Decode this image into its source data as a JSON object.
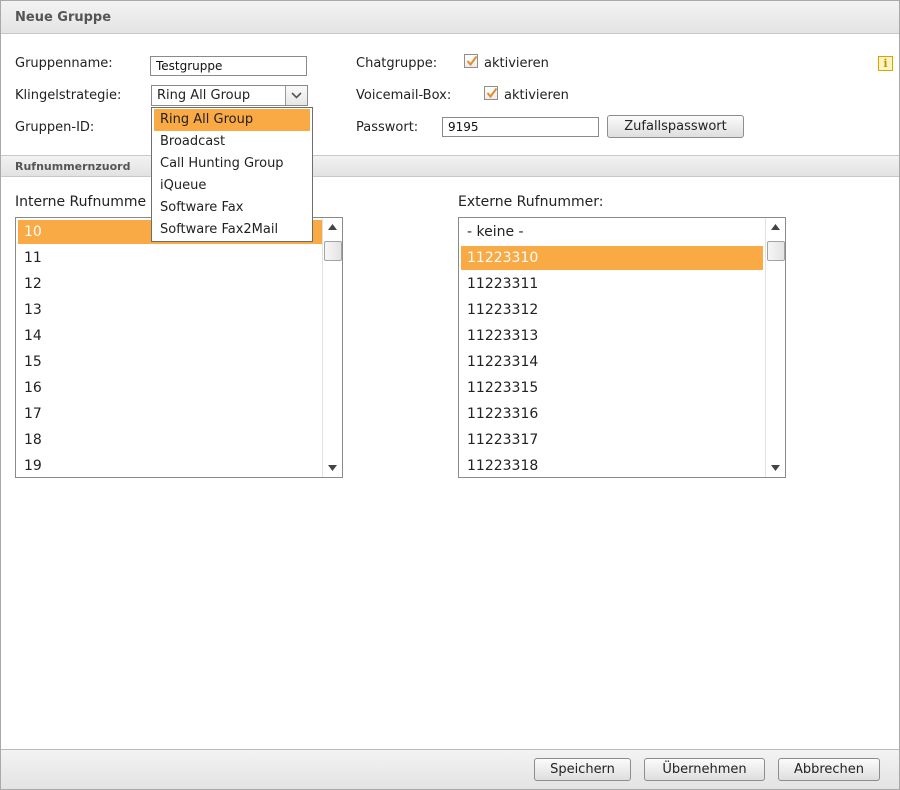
{
  "dialog": {
    "title": "Neue Gruppe",
    "info_icon_glyph": "i"
  },
  "form": {
    "groupname_label": "Gruppenname:",
    "groupname_value": "Testgruppe",
    "ringstrategy_label": "Klingelstrategie:",
    "ringstrategy_value": "Ring All Group",
    "groupid_label": "Gruppen-ID:",
    "chatgroup_label": "Chatgruppe:",
    "chatgroup_checkbox_label": "aktivieren",
    "chatgroup_checked": true,
    "voicemail_label": "Voicemail-Box:",
    "voicemail_checkbox_label": "aktivieren",
    "voicemail_checked": true,
    "password_label": "Passwort:",
    "password_value": "9195",
    "random_password_button": "Zufallspasswort"
  },
  "ringstrategy_dropdown": {
    "options": [
      "Ring All Group",
      "Broadcast",
      "Call Hunting Group",
      "iQueue",
      "Software Fax",
      "Software Fax2Mail"
    ],
    "selected_index": 0
  },
  "section": {
    "title": "Rufnummernzuord"
  },
  "internal_list": {
    "label": "Interne Rufnumme",
    "items": [
      "10",
      "11",
      "12",
      "13",
      "14",
      "15",
      "16",
      "17",
      "18",
      "19"
    ],
    "selected_index": 0
  },
  "external_list": {
    "label": "Externe Rufnummer:",
    "items": [
      "- keine -",
      "11223310",
      "11223311",
      "11223312",
      "11223313",
      "11223314",
      "11223315",
      "11223316",
      "11223317",
      "11223318"
    ],
    "selected_index": 1
  },
  "footer": {
    "save_label": "Speichern",
    "apply_label": "Übernehmen",
    "cancel_label": "Abbrechen"
  },
  "colors": {
    "selection": "#f9aa45",
    "info_icon": "#d9a400",
    "checkmark": "#e0902a"
  },
  "icons": {
    "info": "info-icon",
    "dropdown_arrow": "chevron-down-icon",
    "check": "checkmark-icon",
    "scroll_up": "arrow-up-icon",
    "scroll_down": "arrow-down-icon"
  }
}
